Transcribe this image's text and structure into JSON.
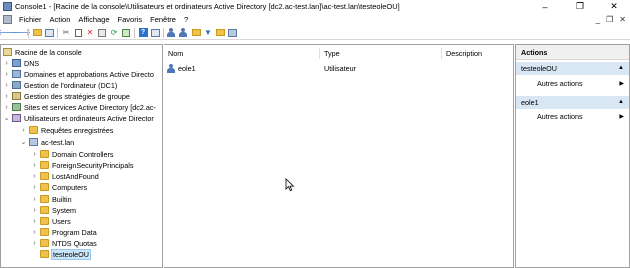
{
  "window": {
    "title": "Console1 - [Racine de la console\\Utilisateurs et ordinateurs Active Directory [dc2.ac-test.lan]\\ac-test.lan\\testeoleOU]",
    "controls": {
      "minimize": "–",
      "maximize": "❐",
      "close": "✕"
    }
  },
  "menubar": {
    "items": [
      "Fichier",
      "Action",
      "Affichage",
      "Favoris",
      "Fenêtre",
      "?"
    ],
    "inner_controls": {
      "minimize": "_",
      "restore": "❐",
      "close": "✕"
    }
  },
  "toolbar": {
    "buttons": [
      "back-icon",
      "forward-icon",
      "up-folder-icon",
      "show-tree-icon",
      "cut-icon",
      "copy-icon",
      "delete-icon",
      "properties-icon",
      "refresh-icon",
      "export-icon",
      "help-icon",
      "view-icon",
      "new-user-icon",
      "new-group-icon",
      "new-ou-icon",
      "filter-icon",
      "find-icon",
      "add-to-group-icon"
    ]
  },
  "tree": {
    "items": [
      {
        "label": "Racine de la console",
        "icon": "console",
        "expander": ""
      },
      {
        "label": "DNS",
        "icon": "dns",
        "expander": "›"
      },
      {
        "label": "Domaines et approbations Active Directo",
        "icon": "domain",
        "expander": "›"
      },
      {
        "label": "Gestion de l'ordinateur (DC1)",
        "icon": "computer",
        "expander": "›"
      },
      {
        "label": "Gestion des stratégies de groupe",
        "icon": "gpo",
        "expander": "›"
      },
      {
        "label": "Sites et services Active Directory [dc2.ac-",
        "icon": "sites",
        "expander": "›"
      },
      {
        "label": "Utilisateurs et ordinateurs Active Director",
        "icon": "users",
        "expander": "⌄"
      },
      {
        "label": "Requêtes enregistrées",
        "icon": "folder",
        "expander": "›"
      },
      {
        "label": "ac-test.lan",
        "icon": "lan",
        "expander": "⌄"
      },
      {
        "label": "Domain Controllers",
        "icon": "folder",
        "expander": "›"
      },
      {
        "label": "ForeignSecurityPrincipals",
        "icon": "folder",
        "expander": "›"
      },
      {
        "label": "LostAndFound",
        "icon": "folder",
        "expander": "›"
      },
      {
        "label": "Computers",
        "icon": "folder",
        "expander": "›"
      },
      {
        "label": "Builtin",
        "icon": "folder",
        "expander": "›"
      },
      {
        "label": "System",
        "icon": "folder",
        "expander": "›"
      },
      {
        "label": "Users",
        "icon": "folder",
        "expander": "›"
      },
      {
        "label": "Program Data",
        "icon": "folder",
        "expander": "›"
      },
      {
        "label": "NTDS Quotas",
        "icon": "folder",
        "expander": "›"
      },
      {
        "label": "testeoleOU",
        "icon": "folder",
        "expander": "",
        "selected": true
      }
    ]
  },
  "list": {
    "columns": [
      "Nom",
      "Type",
      "Description"
    ],
    "rows": [
      {
        "name": "eole1",
        "type": "Utilisateur",
        "description": ""
      }
    ]
  },
  "actions": {
    "title": "Actions",
    "sections": [
      {
        "label": "testeoleOU",
        "items": [
          "Autres actions"
        ]
      },
      {
        "label": "eole1",
        "items": [
          "Autres actions"
        ]
      }
    ],
    "collapse_glyph": "▲",
    "submenu_glyph": "▶"
  },
  "colors": {
    "selection": "#cce4f7",
    "section_bg": "#d9e6f4",
    "folder": "#f0c24b"
  }
}
